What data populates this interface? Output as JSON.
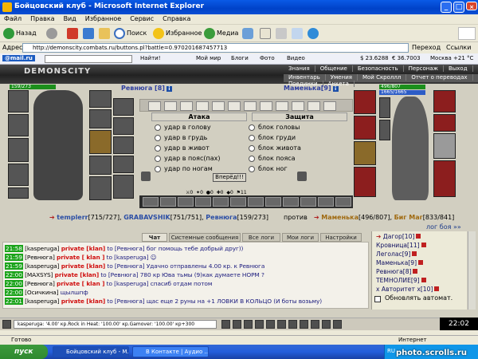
{
  "window": {
    "title": "Бойцовский клуб - Microsoft Internet Explorer",
    "min": "_",
    "max": "□",
    "close": "×"
  },
  "menu": [
    "Файл",
    "Правка",
    "Вид",
    "Избранное",
    "Сервис",
    "Справка"
  ],
  "toolbar": {
    "back": "Назад",
    "search": "Поиск",
    "favorites": "Избранное",
    "media": "Медиа"
  },
  "address": {
    "label": "Адрес:",
    "url": "http://demonscity.combats.ru/buttons.pl?battle=0.970201687457713",
    "go": "Переход",
    "links": "Ссылки"
  },
  "mailbar": {
    "brand": "@mail.ru",
    "find": "Найти!",
    "world": "Мой мир",
    "blogs": "Блоги",
    "photo": "Фото",
    "video": "Видео",
    "usd": "$ 23.6288",
    "eur": "€ 36.7003",
    "weather": "Москва +21 °C"
  },
  "game": {
    "logo": "DEMONSCITY",
    "nav_top": [
      "Знания",
      "Общение",
      "Безопасность",
      "Персонаж",
      "Выход"
    ],
    "nav_bottom": [
      "Инвентарь",
      "Умения",
      "Мой Скроллл",
      "Отчет о переводах",
      "Поединки",
      "Анкета"
    ],
    "left_player": {
      "name": "Ревнюга",
      "level": "[8]",
      "hp": "159/273"
    },
    "right_player": {
      "name": "Маменька",
      "level": "[9]",
      "hp": "496/807",
      "mana": "1665/1665"
    },
    "attack_header": "Атака",
    "defense_header": "Защита",
    "attack_options": [
      "удар в голову",
      "удар в грудь",
      "удар в живот",
      "удар в пояс(пах)",
      "удар по ногам"
    ],
    "defense_options": [
      "блок головы",
      "блок груди",
      "блок живота",
      "блок пояса",
      "блок ног"
    ],
    "forward_button": "Вперёд!!!",
    "counters": [
      "0",
      "0",
      "0",
      "0",
      "0",
      "11"
    ],
    "vs": {
      "p1": "templerr",
      "p1hp": "[715/727]",
      "p2": "GRABAVSHIK",
      "p2hp": "[751/751]",
      "p3": "Ревнюга",
      "p3hp": "[159/273]",
      "vs": "против",
      "p4": "Маменька",
      "p4hp": "[496/807]",
      "p5": "Биг Маг",
      "p5hp": "[833/841]"
    },
    "log_link": "лог боя »»"
  },
  "chat": {
    "tabs": [
      "Чат",
      "Системные сообщения",
      "Все логи",
      "Мои логи",
      "Настройки"
    ],
    "lines": [
      {
        "time": "21:58",
        "from": "[kasperuga]",
        "priv": "private [klan]",
        "rest": " to [Ревнюга] бог помощь тебе добрый друг))"
      },
      {
        "time": "21:59",
        "from": "[Ревнюга]",
        "priv": "private [ klan ]",
        "rest": " to [kasperuga] ☺"
      },
      {
        "time": "21:59",
        "from": "[kasperuga]",
        "priv": "private [klan]",
        "rest": " to [Ревнюга] Удачно отправлены 4.00 кр. к Ревнюга"
      },
      {
        "time": "22:00",
        "from": "[MAXSYS]",
        "priv": "private [klan]",
        "rest": " to [Ревнюга] 780 кр Юва тьмы (9)как думаете НОРМ ?"
      },
      {
        "time": "22:00",
        "from": "[Ревнюга]",
        "priv": "private [ klan ]",
        "rest": " to [kasperuga] спасиб отдам потом"
      },
      {
        "time": "22:00",
        "from": "[Осичкина]",
        "priv": "",
        "rest": " щылшпф"
      },
      {
        "time": "22:01",
        "from": "[kasperuga]",
        "priv": "private [klan]",
        "rest": " to [Ревнюга] щас еще 2 руны на +1 ЛОВКИ В КОЛЬЦО (И боты возьму)"
      }
    ]
  },
  "roster": {
    "items": [
      "Дагор[10]",
      "Кровница[11]",
      "Леголас[9]",
      "Маменька[9]",
      "Ревнюга[8]",
      "ТЕМНОЛИЕ[9]",
      "х Авторитет х[10]"
    ],
    "checkbox_label": "Обновлять автомат."
  },
  "bottom": {
    "input": "kasperuga: '4.00' кр.Rock in Heat: '100.00' кр.Gamover: '100.00' кр+300",
    "clock": "22:02"
  },
  "status": {
    "left": "Готово",
    "zone": "Интернет"
  },
  "taskbar": {
    "start": "пуск",
    "tasks": [
      "Бойцовский клуб - M...",
      "В Контакте | Аудио ..."
    ],
    "lang": "RU"
  },
  "watermark": "photo.scrolls.ru",
  "colors": {
    "titlebar": "#0a4fd4",
    "private": "#d01010",
    "timestamp": "#1aa31a",
    "name": "#3040a0"
  }
}
